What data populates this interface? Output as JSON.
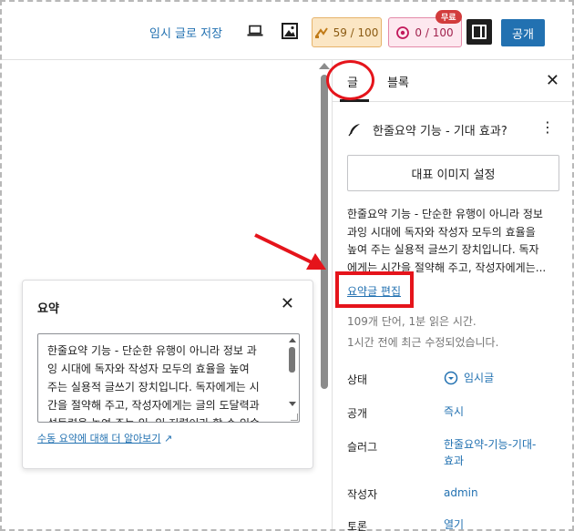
{
  "topbar": {
    "save_draft": "임시 글로 저장",
    "seo_score": "59 / 100",
    "ai_score": "0 / 100",
    "free_tag": "무료",
    "publish": "공개"
  },
  "sidebar": {
    "tab_post": "글",
    "tab_block": "블록",
    "post_title": "한줄요약 기능 - 기대 효과?",
    "featured_image": "대표 이미지 설정",
    "excerpt_lines": [
      "한줄요약 기능 - 단순한 유행이 아니라 정보",
      "과잉 시대에 독자와 작성자 모두의 효율을",
      "높여 주는 실용적 글쓰기 장치입니다. 독자",
      "에게는 시간을 절약해 주고, 작성자에게는..."
    ],
    "edit_excerpt": "요약글 편집",
    "word_count": "109개 단어, 1분 읽은 시간.",
    "last_edited": "1시간 전에 최근 수정되었습니다.",
    "rows": {
      "status_label": "상태",
      "status_value": "임시글",
      "visibility_label": "공개",
      "visibility_value": "즉시",
      "slug_label": "슬러그",
      "slug_value_1": "한줄요약-기능-기대-",
      "slug_value_2": "효과",
      "author_label": "작성자",
      "author_value": "admin",
      "discussion_label": "토론",
      "discussion_value": "열기"
    }
  },
  "popover": {
    "title": "요약",
    "lines": [
      "한줄요약 기능 - 단순한 유행이 아니라 정보 과",
      "잉 시대에 독자와 작성자 모두의 효율을 높여",
      "주는 실용적 글쓰기 장치입니다. 독자에게는 시",
      "간을 절약해 주고, 작성자에게는 글의 도달력과",
      "설득력을 높여 주는 일, 일 저렴이라 할 수 있습"
    ],
    "learn_more": "수동 요약에 대해 더 알아보기",
    "learn_more_arrow": "↗"
  }
}
